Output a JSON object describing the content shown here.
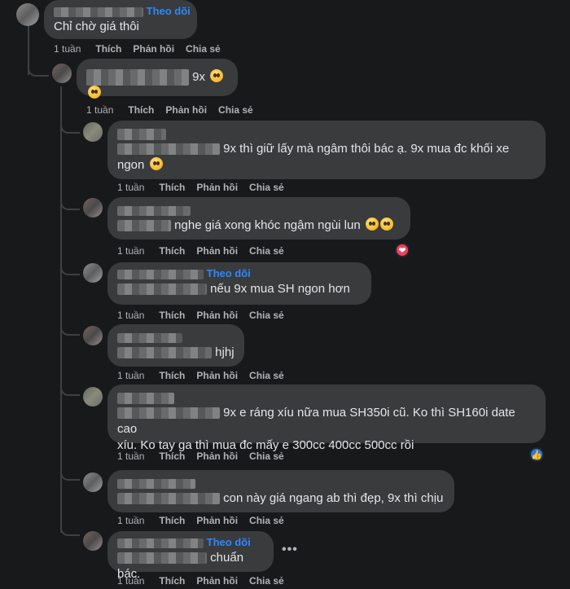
{
  "follow_label": "Theo dõi",
  "actions": {
    "like": "Thích",
    "reply": "Phản hồi",
    "share": "Chia sẻ"
  },
  "comments": [
    {
      "time": "1 tuần",
      "text": "Chỉ chờ giá thôi"
    },
    {
      "time": "1 tuần",
      "text": "9x"
    },
    {
      "time": "1 tuần",
      "text_line1": "9x thì giữ lấy mà ngâm thôi bác ạ. 9x mua đc khối xe",
      "text_line2": "ngon"
    },
    {
      "time": "1 tuần",
      "text": "nghe giá xong khóc ngậm ngùi lun"
    },
    {
      "time": "1 tuần",
      "text": "nếu 9x mua SH ngon hơn"
    },
    {
      "time": "1 tuần",
      "text": "hjhj"
    },
    {
      "time": "1 tuần",
      "text_line1": "9x e ráng xíu nữa mua SH350i cũ. Ko thì SH160i date cao",
      "text_line2": "xíu. Ko tay ga thì mua đc mấy e 300cc 400cc 500cc rồi"
    },
    {
      "time": "1 tuần",
      "text": "con này giá ngang ab thì đẹp, 9x thì chịu"
    },
    {
      "time": "1 tuần",
      "text": "chuẩn bác."
    }
  ],
  "reactions": {
    "heart": "❤",
    "like": "👍"
  },
  "more_label": "•••",
  "icons": [
    "avatar",
    "heart-reaction-icon",
    "like-reaction-icon",
    "more-options-icon",
    "emoji-icon"
  ]
}
